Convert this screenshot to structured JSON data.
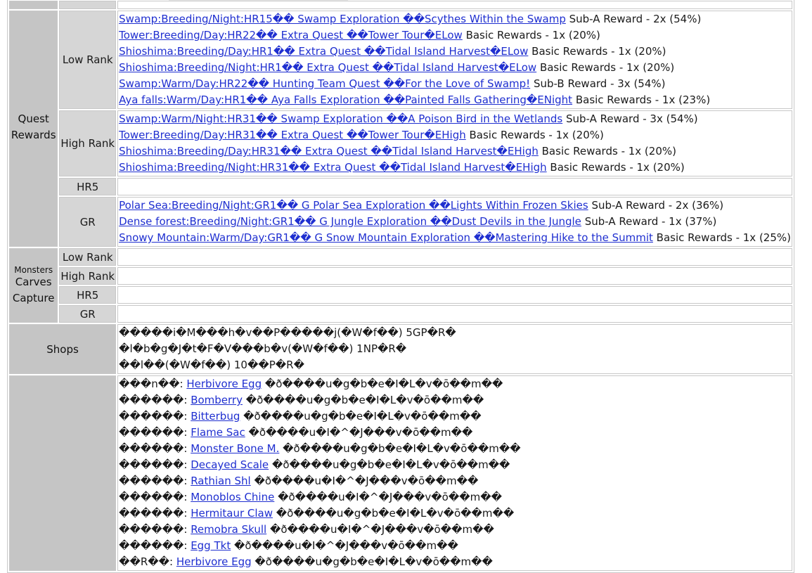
{
  "quest_rewards": {
    "section_label_1": "Quest",
    "section_label_2": "Rewards",
    "low_rank": {
      "label": "Low Rank",
      "items": [
        {
          "link": "Swamp:Breeding/Night:HR15�� Swamp Exploration ��Scythes Within the Swamp",
          "text": " Sub-A Reward - 2x (54%)"
        },
        {
          "link": "Tower:Breeding/Day:HR22�� Extra Quest ��Tower Tour�ELow",
          "text": " Basic Rewards - 1x (20%)"
        },
        {
          "link": "Shioshima:Breeding/Day:HR1�� Extra Quest ��Tidal Island Harvest�ELow",
          "text": " Basic Rewards - 1x (20%)"
        },
        {
          "link": "Shioshima:Breeding/Night:HR1�� Extra Quest ��Tidal Island Harvest�ELow",
          "text": " Basic Rewards - 1x (20%)"
        },
        {
          "link": "Swamp:Warm/Day:HR22�� Hunting Team Quest ��For the Love of Swamp!",
          "text": " Sub-B Reward - 3x (54%)"
        },
        {
          "link": "Aya falls:Warm/Day:HR1�� Aya Falls Exploration ��Painted Falls Gathering�ENight",
          "text": " Basic Rewards - 1x (23%)"
        }
      ]
    },
    "high_rank": {
      "label": "High Rank",
      "items": [
        {
          "link": "Swamp:Warm/Night:HR31�� Swamp Exploration ��A Poison Bird in the Wetlands",
          "text": " Sub-A Reward - 3x (54%)"
        },
        {
          "link": "Tower:Breeding/Day:HR31�� Extra Quest ��Tower Tour�EHigh",
          "text": " Basic Rewards - 1x (20%)"
        },
        {
          "link": "Shioshima:Breeding/Day:HR31�� Extra Quest ��Tidal Island Harvest�EHigh",
          "text": " Basic Rewards - 1x (20%)"
        },
        {
          "link": "Shioshima:Breeding/Night:HR31�� Extra Quest ��Tidal Island Harvest�EHigh",
          "text": " Basic Rewards - 1x (20%)"
        }
      ]
    },
    "hr5": {
      "label": "HR5"
    },
    "gr": {
      "label": "GR",
      "items": [
        {
          "link": "Polar Sea:Breeding/Night:GR1�� G Polar Sea Exploration ��Lights Within Frozen Skies",
          "text": " Sub-A Reward - 2x (36%)"
        },
        {
          "link": "Dense forest:Breeding/Night:GR1�� G Jungle Exploration ��Dust Devils in the Jungle",
          "text": " Sub-A Reward - 1x (37%)"
        },
        {
          "link": "Snowy Mountain:Warm/Day:GR1�� G Snow Mountain Exploration ��Mastering Hike to the Summit",
          "text": " Basic Rewards - 1x (25%)"
        }
      ]
    }
  },
  "monsters": {
    "label_1": "Monsters",
    "label_2": "Carves",
    "label_3": "Capture",
    "rows": [
      "Low Rank",
      "High Rank",
      "HR5",
      "GR"
    ]
  },
  "shops": {
    "label": "Shops",
    "lines": [
      "�����i�M���h�v��P�����j(�W�f��) 5GP�R�",
      "�l�b�g�J�t�F�V���b�v(�W�f��) 1NP�R�",
      "��l��(�W�f��) 10��P�R�"
    ]
  },
  "combos": [
    {
      "prefix": "���n��: ",
      "link": "Herbivore Egg",
      "suffix": " �ð����u�g�b�e�I�L�v�ō��m��"
    },
    {
      "prefix": "������: ",
      "link": "Bomberry",
      "suffix": " �ð����u�g�b�e�I�L�v�ō��m��"
    },
    {
      "prefix": "������: ",
      "link": "Bitterbug",
      "suffix": " �ð����u�g�b�e�I�L�v�ō��m��"
    },
    {
      "prefix": "������: ",
      "link": "Flame Sac",
      "suffix": " �ð����u�I�^�J���v�ō��m��"
    },
    {
      "prefix": "������: ",
      "link": "Monster Bone M.",
      "suffix": " �ð����u�g�b�e�I�L�v�ō��m��"
    },
    {
      "prefix": "������: ",
      "link": "Decayed Scale",
      "suffix": " �ð����u�g�b�e�I�L�v�ō��m��"
    },
    {
      "prefix": "������: ",
      "link": "Rathian Shl",
      "suffix": " �ð����u�I�^�J���v�ō��m��"
    },
    {
      "prefix": "������: ",
      "link": "Monoblos Chine",
      "suffix": " �ð����u�I�^�J���v�ō��m��"
    },
    {
      "prefix": "������: ",
      "link": "Hermitaur Claw",
      "suffix": " �ð����u�g�b�e�I�L�v�ō��m��"
    },
    {
      "prefix": "������: ",
      "link": "Remobra Skull",
      "suffix": " �ð����u�I�^�J���v�ō��m��"
    },
    {
      "prefix": "������: ",
      "link": "Egg Tkt",
      "suffix": " �ð����u�I�^�J���v�ō��m��"
    },
    {
      "prefix": "��R��: ",
      "link": "Herbivore Egg",
      "suffix": " �ð����u�g�b�e�I�L�v�ō��m��"
    }
  ]
}
